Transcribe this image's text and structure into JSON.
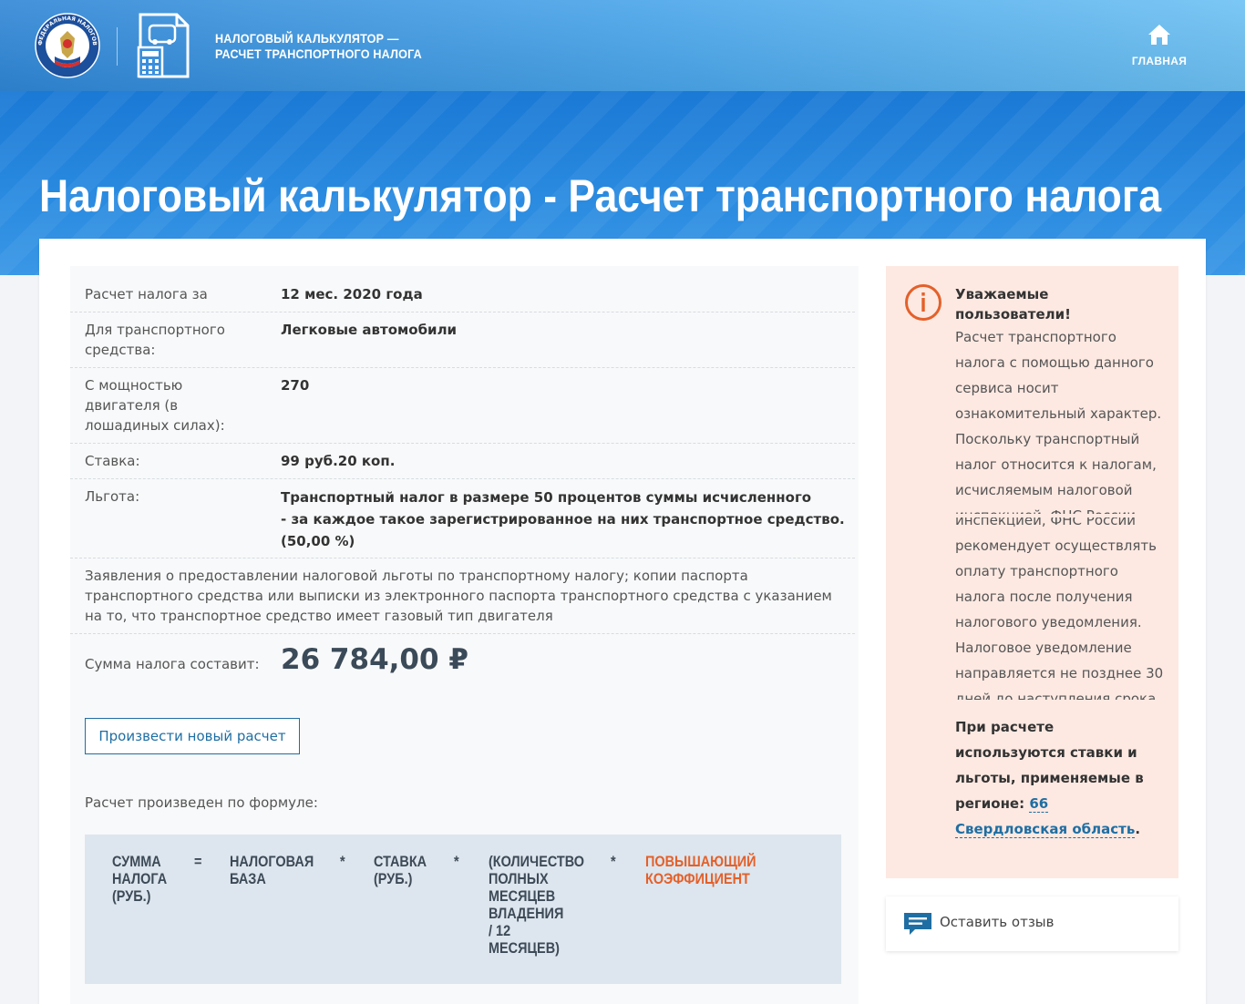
{
  "header": {
    "brand_title": "НАЛОГОВЫЙ КАЛЬКУЛЯТОР —\nРАСЧЕТ ТРАНСПОРТНОГО НАЛОГА",
    "home_label": "ГЛАВНАЯ",
    "logo_text": "ФЕДЕРАЛЬНАЯ НАЛОГОВАЯ СЛУЖБА"
  },
  "page_title": "Налоговый калькулятор - Расчет транспортного налога",
  "result": {
    "rows": [
      {
        "label": "Расчет налога за",
        "value": "12 мес. 2020 года"
      },
      {
        "label": "Для транспортного средства:",
        "value": "Легковые автомобили"
      },
      {
        "label": "С мощностью двигателя (в лошадиных силах):",
        "value": "270"
      },
      {
        "label": "Ставка:",
        "value": "99 руб.20 коп."
      },
      {
        "label": "Льгота:",
        "value": "Транспортный налог в размере 50 процентов суммы исчисленного\n- за каждое такое зарегистрированное на них транспортное средство.\n(50,00 %)"
      }
    ],
    "documents": "Заявления о предоставлении налоговой льготы по транспортному налогу; копии паспорта транспортного средства или выписки из электронного паспорта транспортного средства с указанием на то, что транспортное средство имеет газовый тип двигателя",
    "sum_label": "Сумма налога составит:",
    "sum_value": "26 784,00 ₽",
    "new_calc_button": "Произвести новый расчет",
    "formula_caption": "Расчет произведен по формуле:"
  },
  "formula": {
    "tax_sum": "Сумма\nналога\n(руб.)",
    "equals": "=",
    "tax_base": "Налоговая\nбаза",
    "times": "*",
    "rate": "Ставка\n(руб.)",
    "months": "(Количество\nполных\nмесяцев\nвладения\n/ 12\nмесяцев)",
    "coefficient": "Повышающий\nкоэффициент"
  },
  "info": {
    "title": "Уважаемые\nпользователи!",
    "text": "Расчет транспортного налога с помощью данного сервиса носит ознакомительный характер. Поскольку транспортный налог относится к налогам, исчисляемым налоговой инспекцией, ФНС России рекомендует осуществлять оплату транспортного налога после получения налогового уведомления. Налоговое уведомление направляется не позднее 30 дней до наступления срока уплаты.",
    "bold_text": "При расчете используются ставки и льготы, применяемые в регионе: ",
    "region_link": "66 Свердловская область",
    "bold_end": "."
  },
  "feedback": {
    "label": "Оставить отзыв"
  },
  "colors": {
    "header_blue": "#3a97e6",
    "accent_orange": "#e4602a",
    "link_blue": "#1f6ea3",
    "info_bg": "#fde9e2"
  }
}
